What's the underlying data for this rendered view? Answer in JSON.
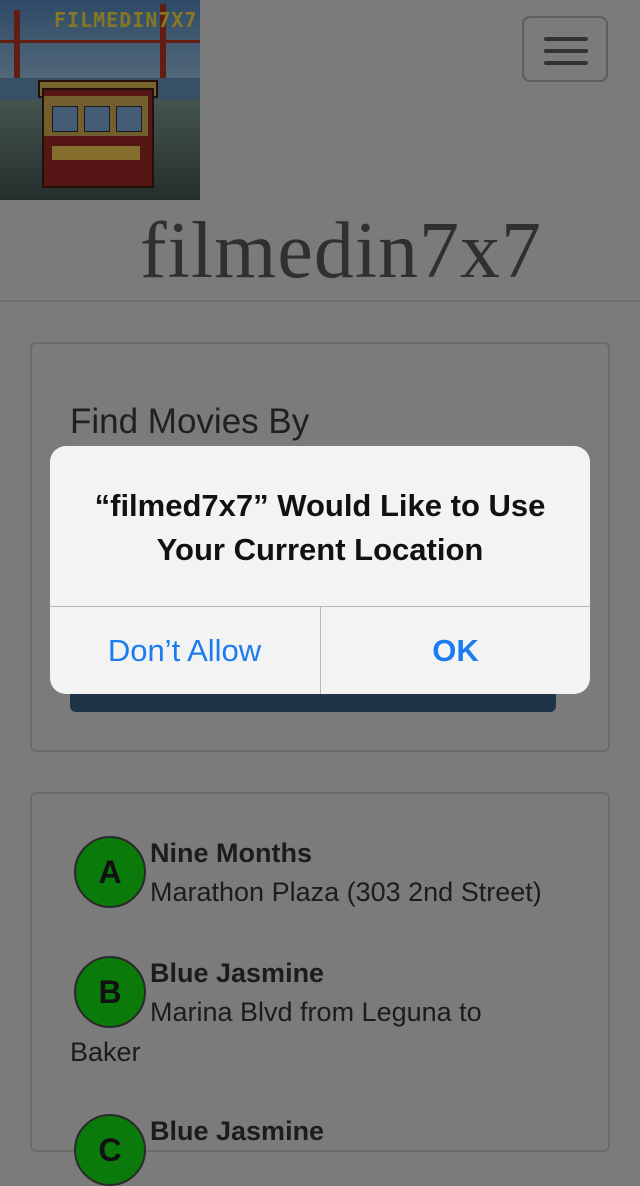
{
  "header": {
    "logo_text": "FILMEDIN7X7",
    "brand_title": "filmedin7x7"
  },
  "finder": {
    "title": "Find Movies By"
  },
  "results": [
    {
      "badge": "A",
      "title": "Nine Months",
      "location": "Marathon Plaza (303 2nd Street)"
    },
    {
      "badge": "B",
      "title": "Blue Jasmine",
      "location": "Marina Blvd from Leguna to Baker"
    },
    {
      "badge": "C",
      "title": "Blue Jasmine",
      "location": ""
    }
  ],
  "alert": {
    "message": "“filmed7x7” Would Like to Use Your Current Location",
    "deny_label": "Don’t Allow",
    "ok_label": "OK"
  },
  "colors": {
    "badge_green": "#11c411",
    "link_blue": "#1a7cf0"
  }
}
